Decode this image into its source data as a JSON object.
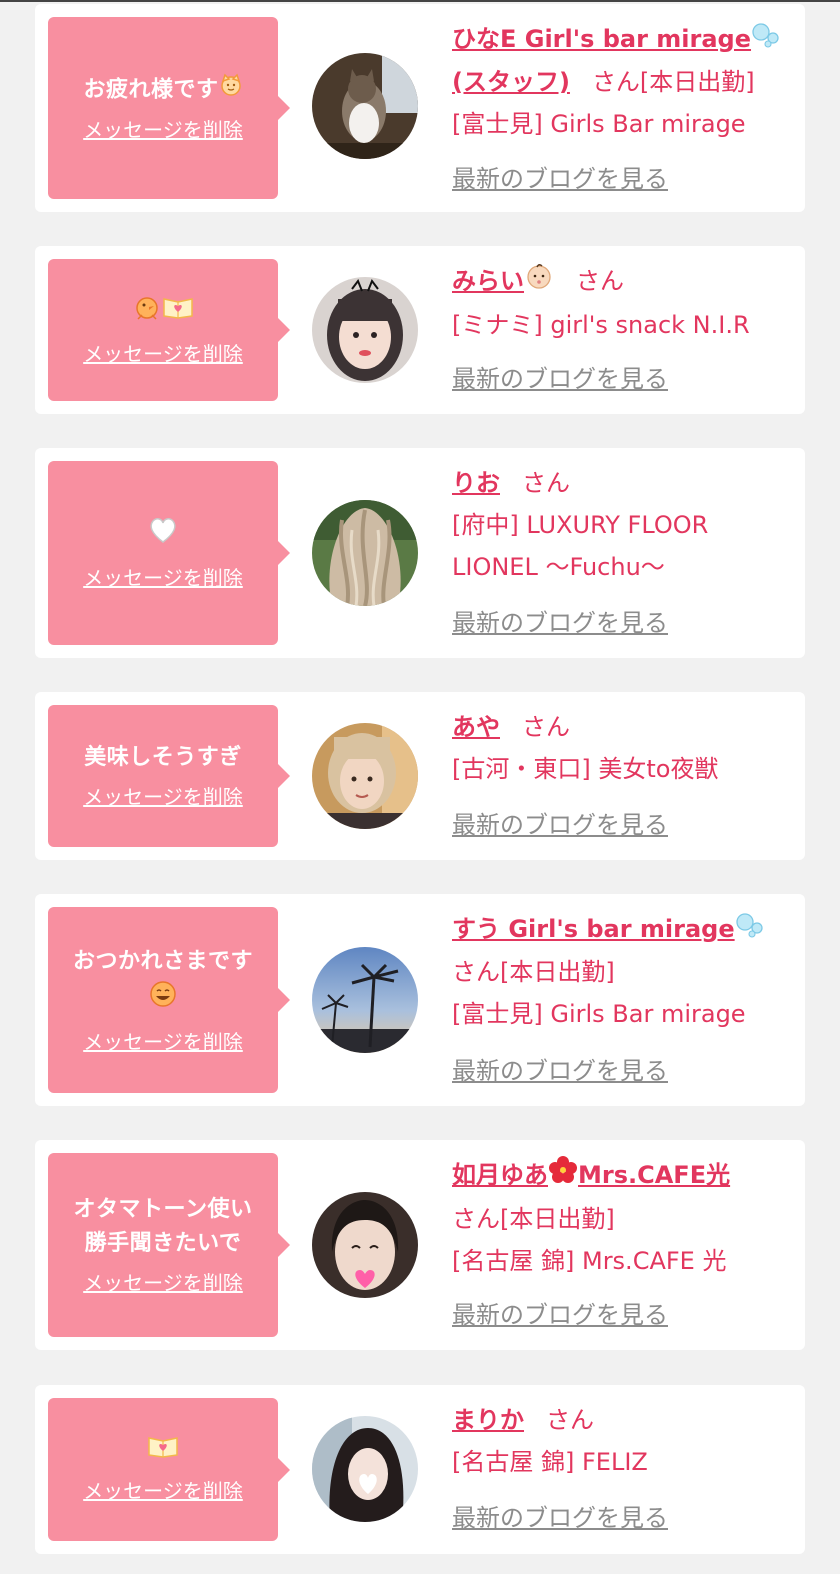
{
  "delete_label": "メッセージを削除",
  "blog_label": "最新のブログを見る",
  "cards": [
    {
      "message": "お疲れ様です",
      "message_emoji": "cat-face-emoji",
      "name": "ひなE Girl's bar mirage",
      "name_cont": "(スタッフ)",
      "name_emoji": "bubbles-emoji",
      "suffix": "さん[本日出勤]",
      "shop": "[富士見] Girls Bar mirage",
      "avatar": "cat-photo"
    },
    {
      "message": "",
      "message_emoji": "chick-and-heart-book-emoji",
      "name": "みらい",
      "name_emoji": "baby-emoji",
      "suffix": "さん",
      "shop": "[ミナミ] girl's snack N.I.R",
      "avatar": "woman-selfie-photo"
    },
    {
      "message": "",
      "message_emoji": "white-heart-emoji",
      "name": "りお",
      "suffix": "さん",
      "shop_line1": "[府中] LUXURY FLOOR",
      "shop_line2": "LIONEL 〜Fuchu〜",
      "avatar": "blonde-hair-photo"
    },
    {
      "message": "美味しそうすぎ",
      "name": "あや",
      "suffix": "さん",
      "shop": "[古河・東口] 美女to夜獣",
      "avatar": "woman-portrait-photo"
    },
    {
      "message": "おつかれさまです",
      "message_emoji": "smiling-face-emoji",
      "name": "すう Girl's bar mirage",
      "name_emoji": "bubbles-emoji",
      "suffix": "さん[本日出勤]",
      "shop": "[富士見] Girls Bar mirage",
      "avatar": "palm-tree-sunset-photo"
    },
    {
      "message_line1": "オタマトーン使い",
      "message_line2": "勝手聞きたいで",
      "name": "如月ゆあ",
      "name_emoji": "hibiscus-emoji",
      "name_tail": "Mrs.CAFE光",
      "suffix": "さん[本日出勤]",
      "shop": "[名古屋 錦] Mrs.CAFE 光",
      "avatar": "woman-heart-face-photo"
    },
    {
      "message": "",
      "message_emoji": "heart-book-emoji",
      "name": "まりか",
      "suffix": "さん",
      "shop": "[名古屋 錦] FELIZ",
      "avatar": "woman-long-hair-photo"
    }
  ],
  "colors": {
    "background": "#f1f1f1",
    "card": "#ffffff",
    "bubble": "#f88fa0",
    "accent": "#e2365e",
    "blog_link": "#8c8c8c"
  }
}
